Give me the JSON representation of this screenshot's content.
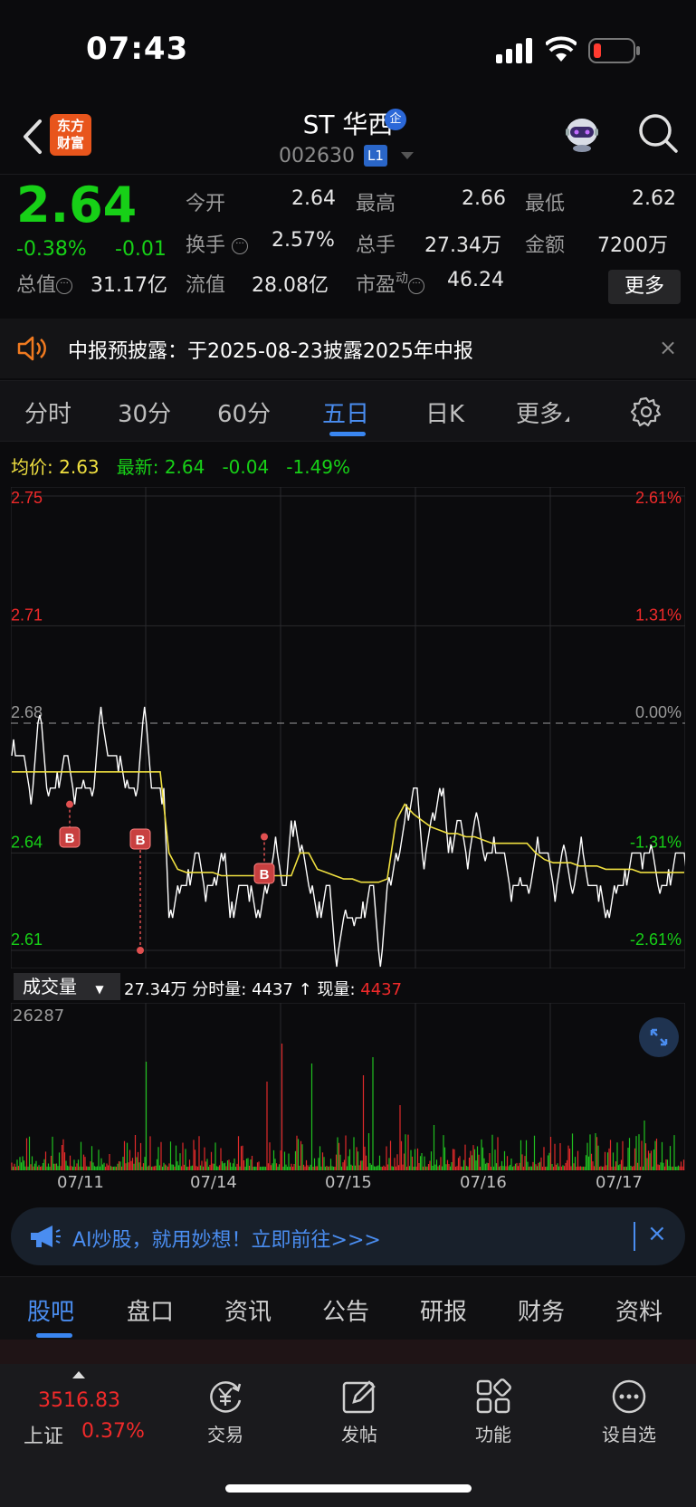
{
  "status": {
    "time": "07:43"
  },
  "nav": {
    "logo": "东方财富",
    "logo_line1": "东方",
    "logo_line2": "财富",
    "stock_name": "ST 华西",
    "badge": "企",
    "code": "002630",
    "level": "L1"
  },
  "quote": {
    "price": "2.64",
    "change_pct": "-0.38%",
    "change": "-0.01",
    "open_label": "今开",
    "open": "2.64",
    "high_label": "最高",
    "high": "2.66",
    "low_label": "最低",
    "low": "2.62",
    "turnover_label": "换手",
    "turnover": "2.57%",
    "volume_label": "总手",
    "volume": "27.34万",
    "amount_label": "金额",
    "amount": "7200万",
    "mcap_label": "总值",
    "mcap": "31.17亿",
    "float_label": "流值",
    "float": "28.08亿",
    "pe_label": "市盈",
    "pe_sup": "动",
    "pe": "46.24",
    "more": "更多"
  },
  "notice": {
    "text": "中报预披露：于2025-08-23披露2025年中报",
    "close": "×"
  },
  "tabs": [
    {
      "label": "分时"
    },
    {
      "label": "30分"
    },
    {
      "label": "60分"
    },
    {
      "label": "五日"
    },
    {
      "label": "日K"
    },
    {
      "label": "更多"
    }
  ],
  "info_line": {
    "avg_label": "均价:",
    "avg": "2.63",
    "latest_label": "最新:",
    "latest": "2.64",
    "chg": "-0.04",
    "chg_pct": "-1.49%"
  },
  "chart_data": {
    "type": "line",
    "title": "",
    "y_ticks_left": [
      "2.75",
      "2.71",
      "2.68",
      "2.64",
      "2.61"
    ],
    "y_ticks_right": [
      "2.61%",
      "1.31%",
      "0.00%",
      "-1.31%",
      "-2.61%"
    ],
    "ylim": [
      2.61,
      2.75
    ],
    "prev_close": 2.68,
    "x_labels": [
      "07/11",
      "07/14",
      "07/15",
      "07/16",
      "07/17"
    ],
    "price_series": [
      2.67,
      2.67,
      2.66,
      2.68,
      2.66,
      2.66,
      2.67,
      2.66,
      2.66,
      2.66,
      2.68,
      2.67,
      2.67,
      2.66,
      2.66,
      2.68,
      2.66,
      2.66,
      2.62,
      2.63,
      2.63,
      2.64,
      2.63,
      2.63,
      2.64,
      2.62,
      2.63,
      2.63,
      2.62,
      2.63,
      2.64,
      2.63,
      2.65,
      2.64,
      2.63,
      2.62,
      2.63,
      2.61,
      2.62,
      2.62,
      2.62,
      2.63,
      2.61,
      2.63,
      2.64,
      2.65,
      2.66,
      2.64,
      2.65,
      2.66,
      2.64,
      2.65,
      2.64,
      2.65,
      2.64,
      2.64,
      2.64,
      2.63,
      2.63,
      2.63,
      2.64,
      2.64,
      2.63,
      2.64,
      2.63,
      2.64,
      2.63,
      2.63,
      2.62,
      2.63,
      2.63,
      2.64,
      2.64,
      2.64,
      2.63,
      2.63,
      2.64,
      2.64
    ],
    "avg_series": [
      2.665,
      2.665,
      2.665,
      2.665,
      2.665,
      2.665,
      2.665,
      2.665,
      2.665,
      2.665,
      2.665,
      2.665,
      2.665,
      2.665,
      2.665,
      2.665,
      2.665,
      2.665,
      2.64,
      2.635,
      2.634,
      2.634,
      2.634,
      2.634,
      2.633,
      2.633,
      2.633,
      2.633,
      2.633,
      2.633,
      2.633,
      2.633,
      2.633,
      2.64,
      2.64,
      2.635,
      2.634,
      2.633,
      2.632,
      2.632,
      2.631,
      2.631,
      2.631,
      2.632,
      2.65,
      2.655,
      2.652,
      2.65,
      2.648,
      2.647,
      2.646,
      2.646,
      2.645,
      2.645,
      2.644,
      2.643,
      2.643,
      2.643,
      2.643,
      2.643,
      2.64,
      2.638,
      2.637,
      2.637,
      2.637,
      2.636,
      2.636,
      2.636,
      2.635,
      2.635,
      2.635,
      2.635,
      2.634,
      2.634,
      2.634,
      2.634,
      2.634,
      2.634
    ],
    "buy_marks": [
      {
        "label": "B"
      },
      {
        "label": "B"
      },
      {
        "label": "B"
      }
    ]
  },
  "volume": {
    "selector": "成交量",
    "total": "27.34万",
    "tick_label": "分时量:",
    "tick": "4437",
    "arrow": "↑",
    "now_label": "现量:",
    "now": "4437",
    "max": "26287"
  },
  "ai": {
    "text": "AI炒股，就用妙想！立即前往>>>",
    "close": "×"
  },
  "bottom_tabs": [
    {
      "label": "股吧"
    },
    {
      "label": "盘口"
    },
    {
      "label": "资讯"
    },
    {
      "label": "公告"
    },
    {
      "label": "研报"
    },
    {
      "label": "财务"
    },
    {
      "label": "资料"
    }
  ],
  "dock": {
    "index_value": "3516.83",
    "index_name": "上证",
    "index_chg": "0.37%",
    "items": [
      {
        "label": "交易"
      },
      {
        "label": "发帖"
      },
      {
        "label": "功能"
      },
      {
        "label": "设自选"
      }
    ]
  },
  "colors": {
    "up": "#f02a2a",
    "down": "#17d017",
    "accent": "#3a86f0",
    "avg": "#f0e040"
  }
}
